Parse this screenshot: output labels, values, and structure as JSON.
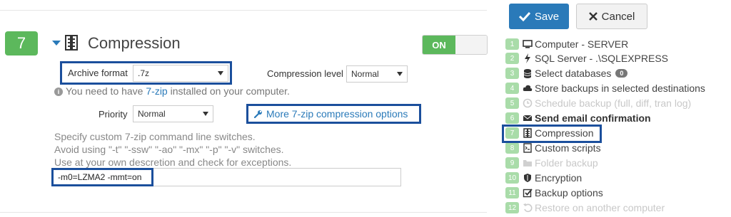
{
  "section": {
    "number": "7",
    "title": "Compression",
    "toggle_label": "ON"
  },
  "form": {
    "archive_format_label": "Archive format",
    "archive_format_value": ".7z",
    "compression_level_label": "Compression level",
    "compression_level_value": "Normal",
    "info_prefix": "You need to have ",
    "info_link": "7-zip",
    "info_suffix": " installed on your computer.",
    "priority_label": "Priority",
    "priority_value": "Normal",
    "more_options_label": "More 7-zip compression options",
    "desc_line1": "Specify custom 7-zip command line switches.",
    "desc_line2": "Avoid using \"-t\" \"-ssw\" \"-ao\" \"-mx\" \"-p\" \"-v\" switches.",
    "desc_line3": "Use at your own descretion and check for exceptions.",
    "switches_value": "-m0=LZMA2 -mmt=on"
  },
  "actions": {
    "save_label": "Save",
    "cancel_label": "Cancel"
  },
  "steps": [
    {
      "num": "1",
      "label": "Computer - SERVER",
      "icon": "monitor-icon"
    },
    {
      "num": "2",
      "label": "SQL Server - .\\SQLEXPRESS",
      "icon": "bolt-icon"
    },
    {
      "num": "3",
      "label": "Select databases",
      "icon": "database-icon",
      "badge": "0"
    },
    {
      "num": "4",
      "label": "Store backups in selected destinations",
      "icon": "cloud-icon"
    },
    {
      "num": "5",
      "label": "Schedule backup (full, diff, tran log)",
      "icon": "clock-icon"
    },
    {
      "num": "6",
      "label": "Send email confirmation",
      "icon": "envelope-icon"
    },
    {
      "num": "7",
      "label": "Compression",
      "icon": "archive-icon"
    },
    {
      "num": "8",
      "label": "Custom scripts",
      "icon": "script-icon"
    },
    {
      "num": "9",
      "label": "Folder backup",
      "icon": "folder-icon"
    },
    {
      "num": "10",
      "label": "Encryption",
      "icon": "shield-icon"
    },
    {
      "num": "11",
      "label": "Backup options",
      "icon": "checkbox-icon"
    },
    {
      "num": "12",
      "label": "Restore on another computer",
      "icon": "undo-icon"
    }
  ],
  "colors": {
    "accent": "#2a7ab9",
    "success": "#5cb85c",
    "highlight": "#1b4f9c"
  }
}
